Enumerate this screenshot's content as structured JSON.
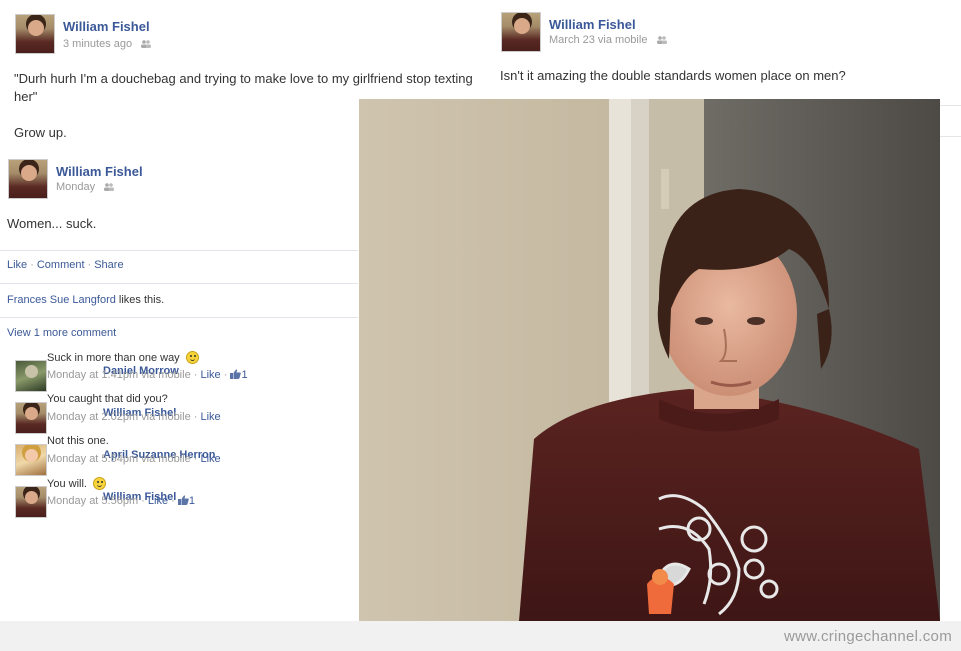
{
  "post1": {
    "author": "William Fishel",
    "time": "3 minutes ago",
    "body": "\"Durh hurh I'm a douchebag and trying to make love to my girlfriend stop texting her\"",
    "body2": "Grow up."
  },
  "post2": {
    "author": "William Fishel",
    "time": "March 23 via mobile",
    "body": "Isn't it amazing the double standards women place on men?"
  },
  "post3": {
    "author": "William Fishel",
    "time": "Monday",
    "body": "Women... suck.",
    "actions": {
      "like": "Like",
      "sep1": "·",
      "comment": "Comment",
      "sep2": "·",
      "share": "Share"
    },
    "likes": {
      "person": "Frances Sue Langford",
      "suffix": " likes this."
    },
    "view_more": "View 1 more comment",
    "comments": [
      {
        "author": "Daniel Morrow",
        "text": "Suck in more than one way",
        "time": "Monday at 1:41pm via mobile",
        "like": "Like",
        "like_count": "1",
        "smiley": true
      },
      {
        "author": "William Fishel",
        "text": "You caught that did you?",
        "time": "Monday at 2:02pm via mobile",
        "like": "Like"
      },
      {
        "author": "April Suzanne Herron",
        "text": "Not this one.",
        "time": "Monday at 5:54pm via mobile",
        "like": "Like"
      },
      {
        "author": "William Fishel",
        "text": "You will.",
        "time": "Monday at 5:56pm",
        "like": "Like",
        "like_count": "1",
        "smiley": true
      }
    ]
  },
  "watermark": "www.cringechannel.com",
  "colors": {
    "link": "#3b5998",
    "meta": "#999999",
    "footer_bg": "#f1f1f1"
  },
  "icons": [
    "people-icon",
    "smiley-icon",
    "thumbs-up-icon"
  ]
}
